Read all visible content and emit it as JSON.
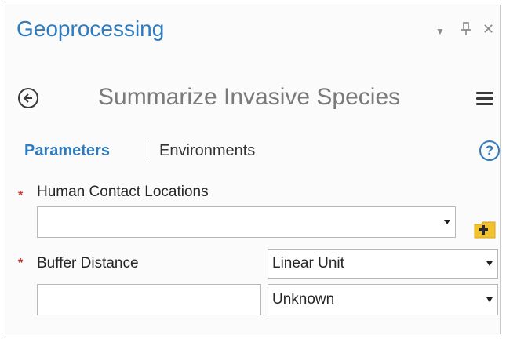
{
  "header": {
    "title": "Geoprocessing",
    "controls": {
      "dropdown_icon": "triangle-down",
      "pin_icon": "pin",
      "close_icon": "close-x"
    }
  },
  "tool": {
    "name": "Summarize Invasive Species",
    "back_icon": "back-arrow-circle",
    "menu_icon": "hamburger-menu"
  },
  "tabs": {
    "parameters": "Parameters",
    "environments": "Environments",
    "help": "?"
  },
  "parameters": {
    "human_contact": {
      "required_mark": "*",
      "label": "Human Contact Locations",
      "value": "",
      "browse_icon": "folder-add"
    },
    "buffer_distance": {
      "required_mark": "*",
      "label": "Buffer Distance",
      "value": "",
      "type_selected": "Linear Unit",
      "unit_selected": "Unknown"
    }
  },
  "colors": {
    "accent": "#2f7bbd",
    "required": "#c0392b",
    "folder": "#f2c12e"
  }
}
